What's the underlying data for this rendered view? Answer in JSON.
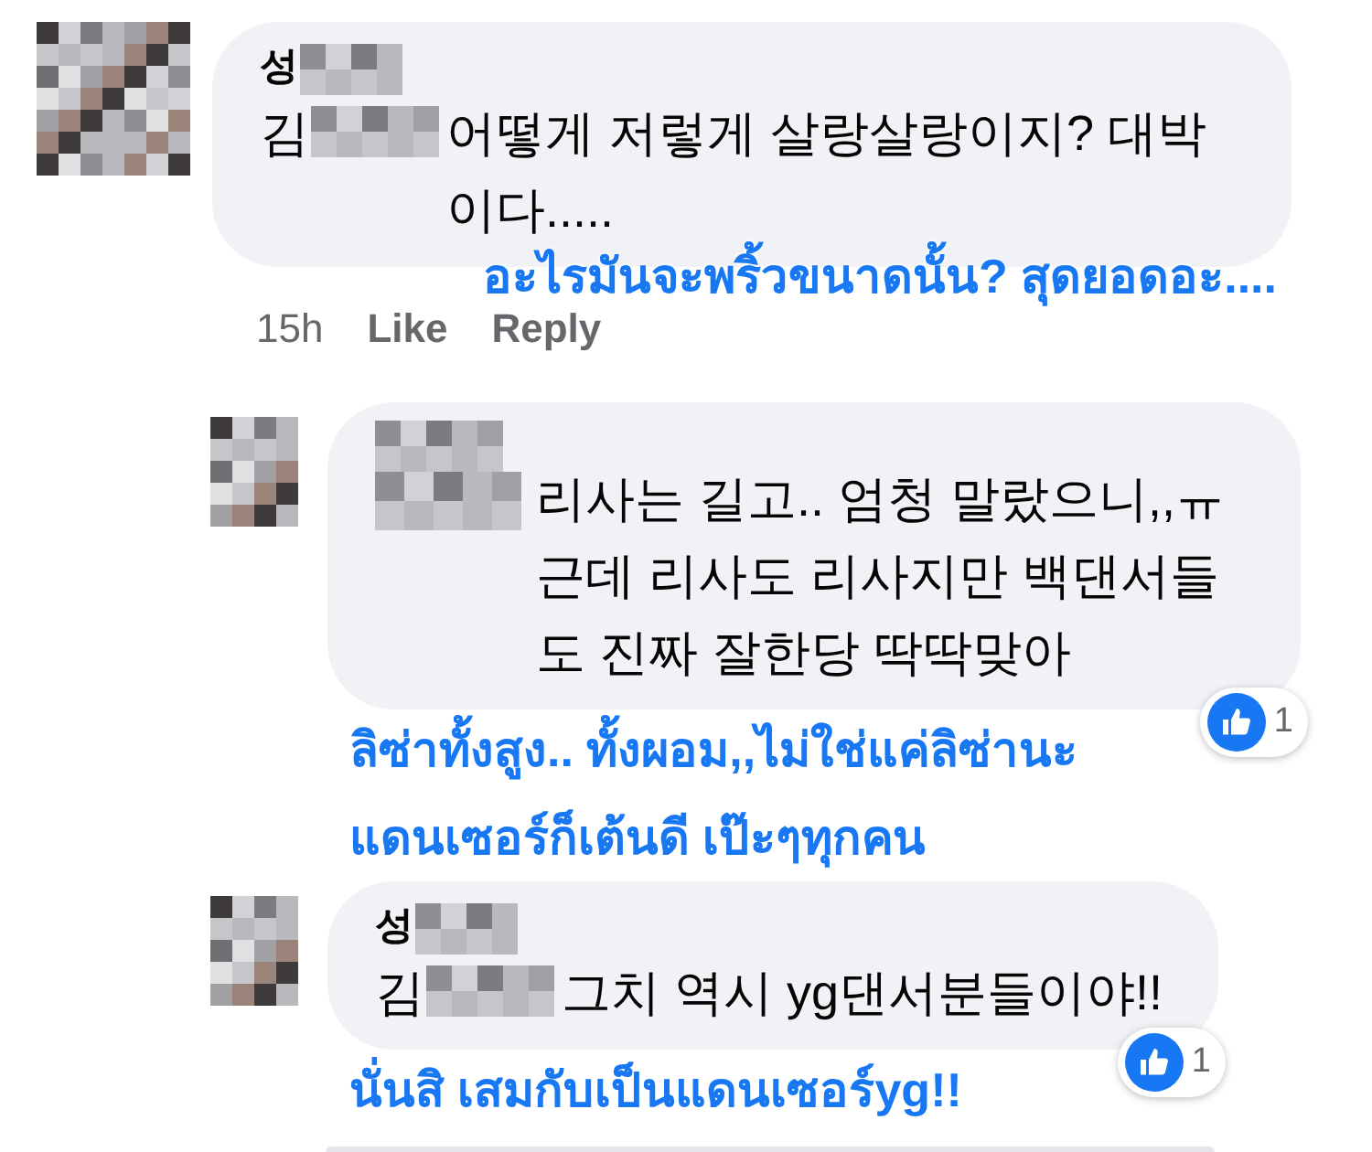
{
  "comments": [
    {
      "name_visible": "성",
      "body_start": "김",
      "body": "어떻게 저렇게 살랑살랑이지? 대박이다.....",
      "captions": [
        "อะไรมันจะพริ้วขนาดนั้น? สุดยอดอะ...."
      ],
      "time": "15h",
      "like": "Like",
      "reply": "Reply",
      "reply_level": false
    },
    {
      "body": "리사는 길고.. 엄청 말랐으니,,ㅠ 근데 리사도 리사지만 백댄서들도 진짜 잘한당 딱딱맞아",
      "captions": [
        "ลิซ่าทั้งสูง.. ทั้งผอม,,ไม่ใช่แค่ลิซ่านะ",
        "แดนเซอร์ก็เต้นดี เป๊ะๆทุกคน"
      ],
      "reactions": "1",
      "reply_level": true
    },
    {
      "name_visible": "성",
      "body_start": "김",
      "body": "그치 역시 yg댄서분들이야!!",
      "captions": [
        "นั่นสิ เสมกับเป็นแดนเซอร์yg!!"
      ],
      "reactions": "1",
      "reply_level": true
    }
  ]
}
